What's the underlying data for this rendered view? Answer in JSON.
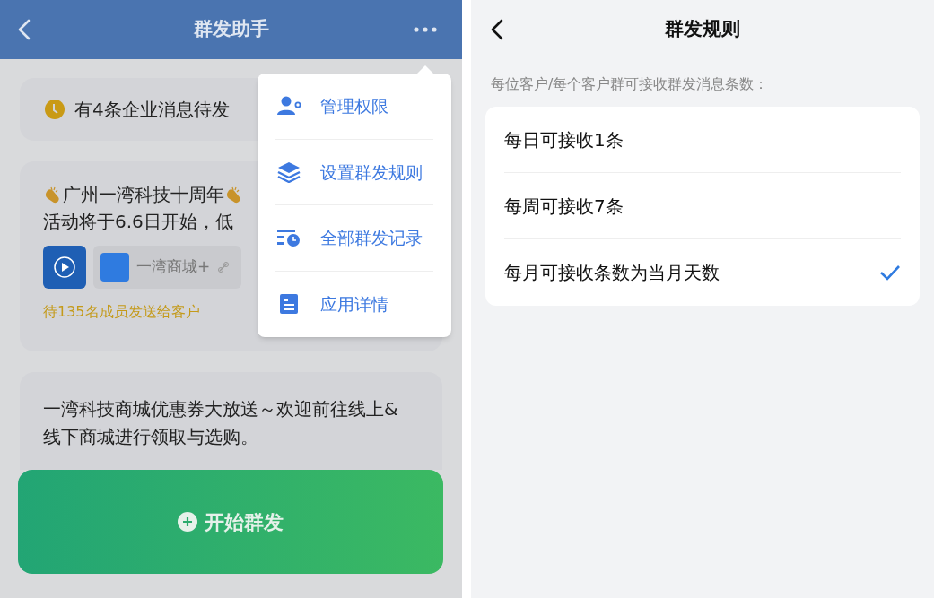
{
  "left_screen": {
    "header": {
      "title": "群发助手"
    },
    "notice": {
      "text": "有4条企业消息待发"
    },
    "messages": [
      {
        "kind": "rich",
        "title": "广州一湾科技十周年",
        "body": "活动将于6.6日开始，低",
        "attachment_label": "一湾商城+",
        "status": "待135名成员发送给客户"
      },
      {
        "kind": "plain",
        "body": "一湾科技商城优惠券大放送～欢迎前往线上&线下商城进行领取与选购。"
      }
    ],
    "menu": [
      {
        "kind": "admin",
        "label": "管理权限"
      },
      {
        "kind": "layers",
        "label": "设置群发规则"
      },
      {
        "kind": "history",
        "label": "全部群发记录"
      },
      {
        "kind": "details",
        "label": "应用详情"
      }
    ],
    "start_button": {
      "label": "开始群发"
    }
  },
  "right_screen": {
    "header": {
      "title": "群发规则"
    },
    "subtitle": "每位客户/每个客户群可接收群发消息条数：",
    "rules": [
      {
        "label": "每日可接收1条",
        "selected": false
      },
      {
        "label": "每周可接收7条",
        "selected": false
      },
      {
        "label": "每月可接收条数为当月天数",
        "selected": true
      }
    ]
  }
}
